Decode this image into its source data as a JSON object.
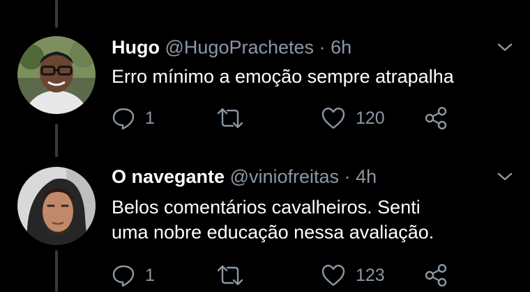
{
  "tweets": [
    {
      "name": "Hugo",
      "handle": "@HugoPrachetes",
      "separator": "·",
      "time": "6h",
      "text_lines": [
        "Erro mínimo a emoção sempre atrapalha"
      ],
      "reply_count": "1",
      "retweet_count": "",
      "like_count": "120",
      "avatar_icon": "avatar-photo-glasses-man"
    },
    {
      "name": "O navegante",
      "handle": "@viniofreitas",
      "separator": "·",
      "time": "4h",
      "text_lines": [
        "Belos comentários cavalheiros. Senti",
        "uma nobre educação nessa avaliação."
      ],
      "reply_count": "1",
      "retweet_count": "",
      "like_count": "123",
      "avatar_icon": "avatar-photo-hooded-man"
    }
  ],
  "icons": {
    "reply": "reply-icon",
    "retweet": "retweet-icon",
    "like": "like-icon",
    "share": "share-icon",
    "more": "chevron-down-icon"
  },
  "colors": {
    "background": "#000000",
    "text": "#ffffff",
    "secondary": "#8b98a5",
    "thread_line": "#3a3a3a"
  }
}
